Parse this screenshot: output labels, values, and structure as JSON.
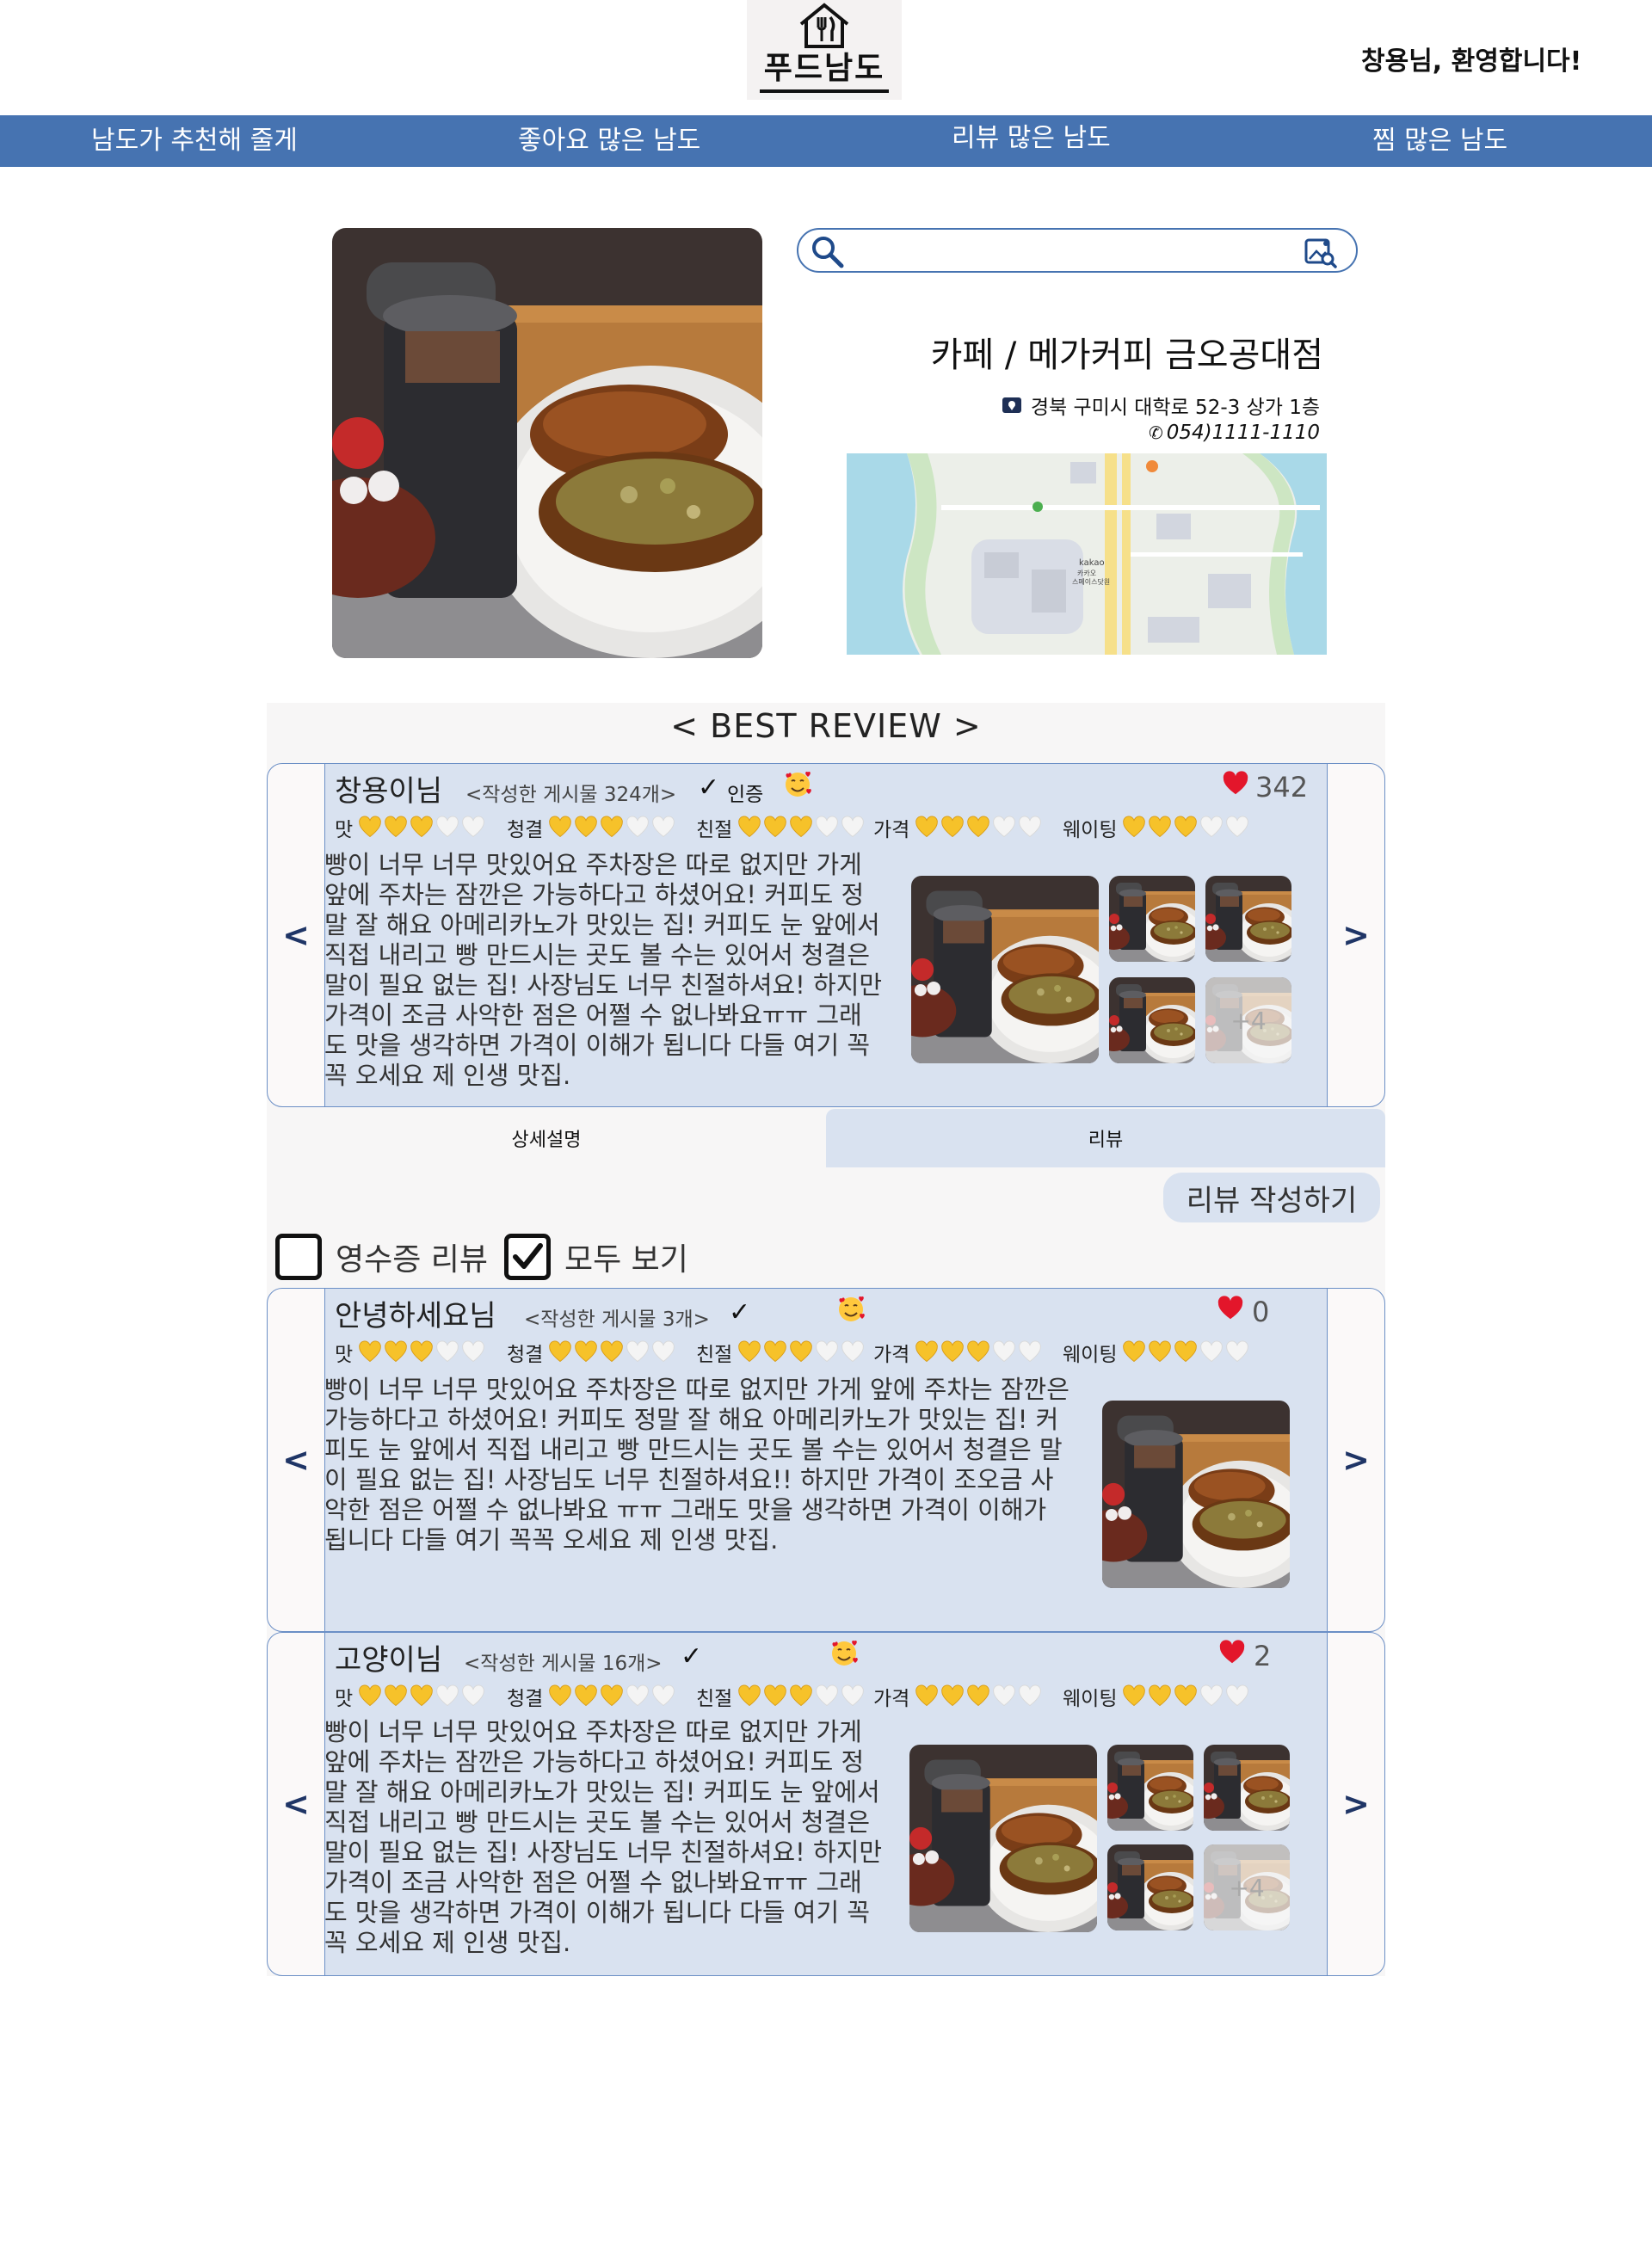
{
  "header": {
    "logo_text": "푸드남도",
    "welcome": "창용님, 환영합니다!"
  },
  "nav": [
    {
      "label": "남도가 추천해 줄게"
    },
    {
      "label": "좋아요 많은 남도"
    },
    {
      "label": "리뷰 많은 남도"
    },
    {
      "label": "찜 많은 남도"
    }
  ],
  "search": {
    "value": "",
    "placeholder": ""
  },
  "store": {
    "title": "카페 / 메가커피 금오공대점",
    "address": "경북 구미시 대학로 52-3 상가 1층",
    "phone": "054)1111-1110"
  },
  "map": {
    "labels": [
      "kakao",
      "카카오",
      "스페이스닷원"
    ]
  },
  "best_review_title": "< BEST REVIEW >",
  "rating_labels": [
    "맛",
    "청결",
    "친절",
    "가격",
    "웨이팅"
  ],
  "reviews": [
    {
      "author": "창용이님",
      "post_count": "<작성한 게시물 324개>",
      "check": "✓",
      "verified": "인증",
      "likes": "342",
      "ratings": [
        3,
        3,
        3,
        3,
        3
      ],
      "text": "빵이 너무 너무 맛있어요  주차장은 따로 없지만 가게 앞에 주차는 잠깐은 가능하다고 하셨어요! 커피도 정말 잘 해요 아메리카노가 맛있는 집! 커피도 눈 앞에서 직접 내리고 빵 만드시는 곳도 볼 수는 있어서 청결은 말이 필요 없는 집! 사장님도 너무 친절하셔요! 하지만 가격이 조금 사악한 점은 어쩔 수 없나봐요ㅠㅠ 그래도 맛을 생각하면 가격이 이해가 됩니다 다들 여기 꼭꼭 오세요 제 인생 맛집.",
      "more_photos": "+4"
    },
    {
      "author": "안녕하세요님",
      "post_count": "<작성한 게시물 3개>",
      "check": "✓",
      "likes": "0",
      "ratings": [
        3,
        3,
        3,
        3,
        3
      ],
      "text": "빵이 너무 너무 맛있어요  주차장은 따로 없지만 가게 앞에 주차는 잠깐은 가능하다고 하셨어요! 커피도 정말 잘 해요 아메리카노가 맛있는 집! 커피도 눈 앞에서 직접 내리고 빵 만드시는 곳도 볼 수는 있어서 청결은 말이 필요 없는 집! 사장님도 너무 친절하셔요!! 하지만 가격이 조오금 사악한 점은 어쩔 수 없나봐요 ㅠㅠ 그래도 맛을 생각하면 가격이 이해가 됩니다 다들 여기 꼭꼭 오세요 제 인생 맛집."
    },
    {
      "author": "고양이님",
      "post_count": "<작성한 게시물 16개>",
      "check": "✓",
      "likes": "2",
      "ratings": [
        3,
        3,
        3,
        3,
        3
      ],
      "text": "빵이 너무 너무 맛있어요  주차장은 따로 없지만 가게 앞에 주차는 잠깐은 가능하다고 하셨어요! 커피도 정말 잘 해요 아메리카노가 맛있는 집! 커피도 눈 앞에서 직접 내리고 빵 만드시는 곳도 볼 수는 있어서 청결은 말이 필요 없는 집! 사장님도 너무 친절하셔요! 하지만 가격이 조금 사악한 점은 어쩔 수 없나봐요ㅠㅠ 그래도 맛을 생각하면 가격이 이해가 됩니다 다들 여기 꼭꼭 오세요 제 인생 맛집.",
      "more_photos": "+4"
    }
  ],
  "arrows": {
    "prev": "<",
    "next": ">"
  },
  "tabs": [
    {
      "label": "상세설명"
    },
    {
      "label": "리뷰"
    }
  ],
  "write_review_label": "리뷰 작성하기",
  "filters": [
    {
      "label": "영수증 리뷰",
      "checked": false
    },
    {
      "label": "모두 보기",
      "checked": true
    }
  ],
  "icons": {
    "logo": "house-fork-knife-icon",
    "search": "search-icon",
    "image_search": "image-search-icon",
    "address": "location-icon",
    "phone": "phone-icon",
    "like": "red-heart-icon",
    "emoji": "smiling-face-with-hearts-icon",
    "rating": "yellow-heart-icon"
  },
  "colors": {
    "nav": "#4673b1",
    "card": "#d9e2f0",
    "card_border": "#6b8fc6",
    "heart_red": "#e3162b",
    "heart_yellow": "#f6c22a"
  }
}
